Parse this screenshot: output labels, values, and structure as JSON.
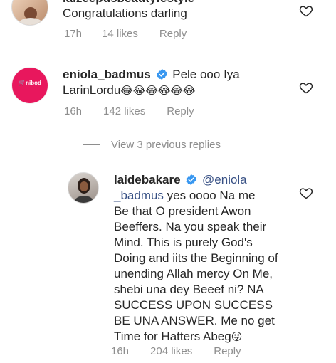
{
  "comment1": {
    "username_partial": "laizeepusbeautyfestyle",
    "text": "Congratulations darling",
    "time": "17h",
    "likes": "14 likes",
    "reply": "Reply"
  },
  "comment2": {
    "username": "eniola_badmus",
    "avatar_brand": "nibod",
    "text_line1": "Pele ooo Iya",
    "text_line2": "LarinLordu",
    "emojis": "😂😂😂😂😂😂",
    "time": "16h",
    "likes": "142 likes",
    "reply": "Reply"
  },
  "view_replies": "View 3 previous replies",
  "reply1": {
    "username": "laidebakare",
    "mention_part1": "@eniola",
    "mention_part2": "_badmus",
    "lines": [
      " yes oooo Na me",
      "Be that O president Awon",
      "Beeffers.  Na you speak their",
      "Mind. This is purely God's",
      "Doing and iits the Beginning of",
      "unending Allah mercy On Me,",
      "shebi una dey Beeef ni?  NA",
      "SUCCESS UPON SUCCESS",
      "BE UNA ANSWER. Me no get",
      "Time for Hatters Abeg"
    ],
    "emoji": "😜",
    "time": "16h",
    "likes": "204 likes",
    "reply": "Reply"
  },
  "colors": {
    "text": "#262626",
    "meta": "#8e8e8e",
    "verified": "#3897f0",
    "brand_pink": "#e8175d"
  }
}
